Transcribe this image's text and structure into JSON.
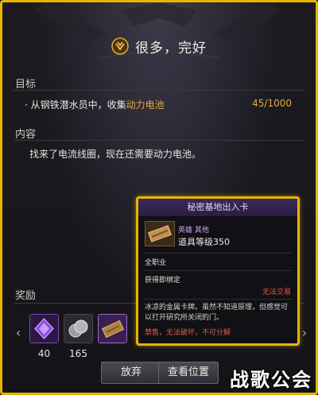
{
  "dialog": {
    "title": "很多，完好"
  },
  "objective": {
    "label": "目标",
    "text_prefix": "· 从钢铁潜水员中，收集",
    "text_highlight": "动力电池",
    "progress": "45/1000"
  },
  "content": {
    "label": "内容",
    "text": "找来了电流线圈，现在还需要动力电池。"
  },
  "rewards": {
    "label": "奖励",
    "items": [
      {
        "name": "purple-crystal",
        "count": "40"
      },
      {
        "name": "silver-coins",
        "count": "165"
      },
      {
        "name": "access-card",
        "count": ""
      }
    ]
  },
  "buttons": {
    "abandon": "放弃",
    "view_location": "查看位置"
  },
  "tooltip": {
    "title": "秘密基地出入卡",
    "tags": "英雄  其他",
    "item_level": "道具等级350",
    "class": "全职业",
    "bind": "获得即绑定",
    "no_trade": "无法交易",
    "description": "冰凉的金属卡牌。虽然不知道原理，但感觉可以打开研究所关闭的门。",
    "restrictions": "禁售，无法破坏，不可分解"
  },
  "watermark": {
    "text": "战歌公会"
  },
  "colors": {
    "frame_border": "#e8b400",
    "highlight_orange": "#e8a83c",
    "tooltip_header": "#3a2a58",
    "warning_red": "#e05a48"
  }
}
